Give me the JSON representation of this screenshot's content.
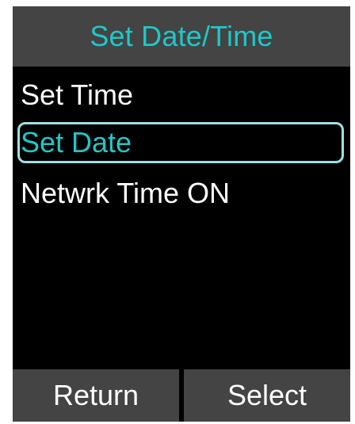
{
  "header": {
    "title": "Set Date/Time"
  },
  "menu": {
    "items": [
      {
        "label": "Set Time",
        "selected": false
      },
      {
        "label": "Set Date",
        "selected": true
      },
      {
        "label": "Netwrk Time ON",
        "selected": false
      }
    ]
  },
  "softkeys": {
    "left_label": "Return",
    "right_label": "Select"
  },
  "colors": {
    "screen_background": "#000000",
    "bar_background": "#444444",
    "accent": "#1fc8c8",
    "selection_border": "#9fe0e0",
    "text": "#ffffff"
  }
}
